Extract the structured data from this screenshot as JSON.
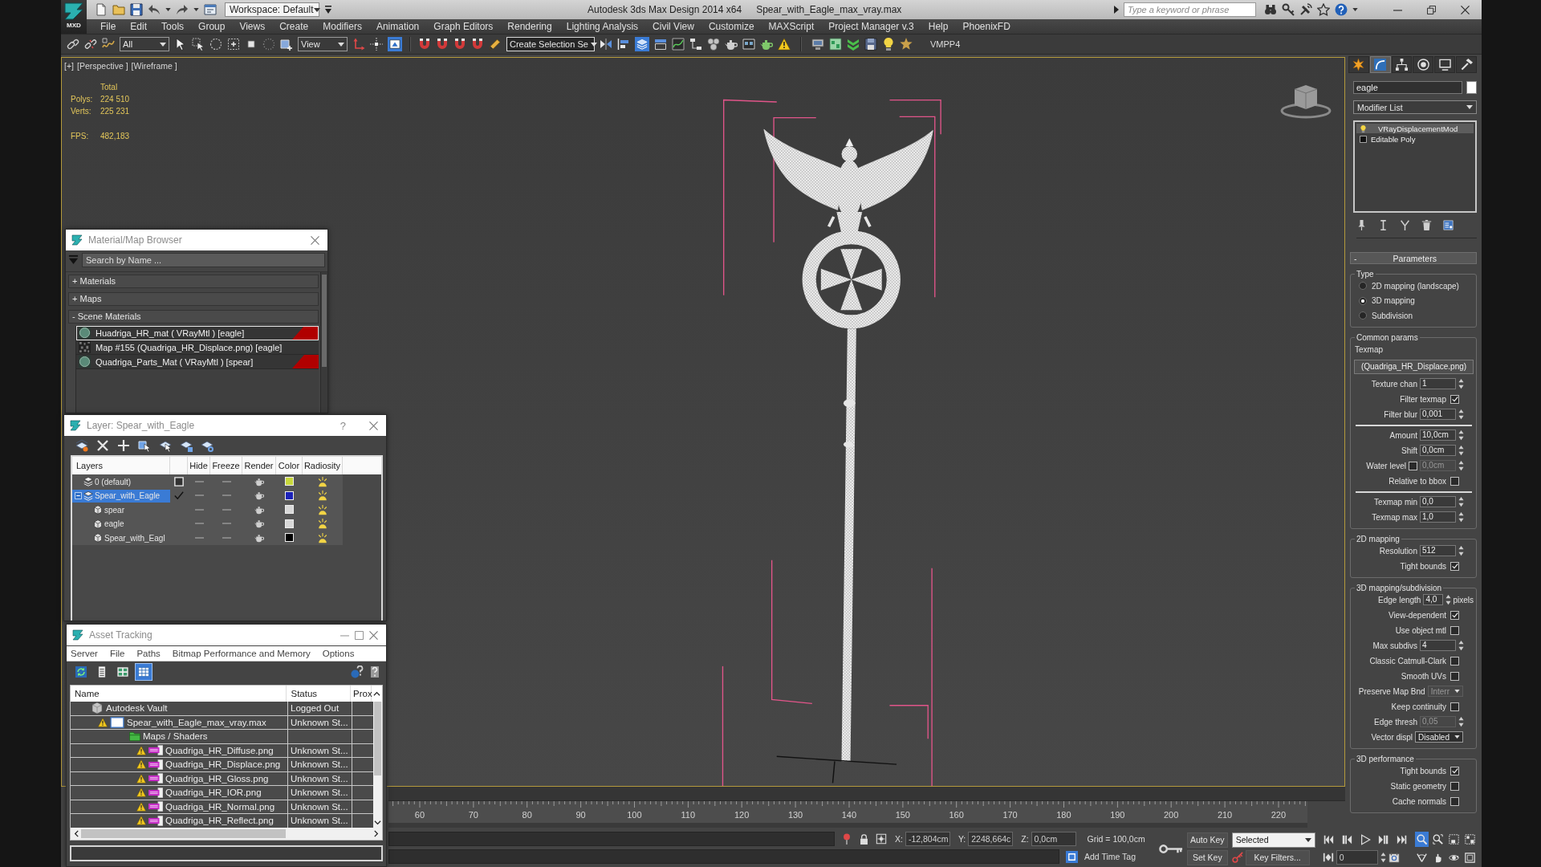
{
  "title_bar": {
    "app_button": "MXD",
    "workspace": "Workspace: Default",
    "app_title": "Autodesk 3ds Max Design 2014 x64",
    "file_name": "Spear_with_Eagle_max_vray.max",
    "search": {
      "placeholder": "Type a keyword or phrase"
    }
  },
  "menu_bar": [
    "File",
    "Edit",
    "Tools",
    "Group",
    "Views",
    "Create",
    "Modifiers",
    "Animation",
    "Graph Editors",
    "Rendering",
    "Lighting Analysis",
    "Civil View",
    "Customize",
    "MAXScript",
    "Project Manager v.3",
    "Help",
    "PhoenixFD"
  ],
  "toolbar": {
    "selection_filter": "All",
    "reference_coordinates": "View",
    "named_selection": "Create Selection Se",
    "shortcut_override": {
      "on": true
    },
    "layer_explorer": {
      "on": true
    },
    "plugin_label": "VMPP4"
  },
  "viewport": {
    "labels": [
      "[+]",
      "[Perspective ]",
      "[Wireframe ]"
    ],
    "stats": {
      "heading": "Total",
      "rows": [
        {
          "label": "Polys:",
          "value": "224 510"
        },
        {
          "label": "Verts:",
          "value": "225 231"
        }
      ],
      "fps": {
        "label": "FPS:",
        "value": "482,183"
      }
    }
  },
  "material_browser": {
    "title": "Material/Map Browser",
    "search": {
      "placeholder": "Search by Name ..."
    },
    "groups": [
      {
        "sign": "+",
        "label": "Materials"
      },
      {
        "sign": "+",
        "label": "Maps"
      },
      {
        "sign": "-",
        "label": "Scene Materials",
        "items": [
          {
            "kind": "material",
            "name": "Huadriga_HR_mat ( VRayMtl ) [eagle]",
            "selected": true,
            "in_scene": true
          },
          {
            "kind": "map",
            "name": "Map #155 (Quadriga_HR_Displace.png) [eagle]",
            "selected": false,
            "in_scene": false
          },
          {
            "kind": "material",
            "name": "Quadriga_Parts_Mat ( VRayMtl ) [spear]",
            "selected": false,
            "in_scene": true
          }
        ]
      }
    ]
  },
  "layer_manager": {
    "title": "Layer: Spear_with_Eagle",
    "help": "?",
    "columns": [
      "Layers",
      "Hide",
      "Freeze",
      "Render",
      "Color",
      "Radiosity"
    ],
    "layers": [
      {
        "kind": "layer",
        "name": "0 (default)",
        "current": false,
        "selected": false,
        "hidden": false,
        "frozen": false,
        "renderable": true,
        "radiosity": true,
        "color": "#c8d83c"
      },
      {
        "kind": "layer",
        "name": "Spear_with_Eagle",
        "current": true,
        "selected": true,
        "expanded": true,
        "hidden": false,
        "frozen": false,
        "renderable": true,
        "radiosity": true,
        "color": "#1c22b8",
        "children": [
          {
            "kind": "object",
            "name": "spear",
            "selected": false,
            "hidden": false,
            "frozen": false,
            "renderable": true,
            "radiosity": true,
            "color": "#d8d8d8"
          },
          {
            "kind": "object",
            "name": "eagle",
            "selected": false,
            "hidden": false,
            "frozen": false,
            "renderable": true,
            "radiosity": true,
            "color": "#d8d8d8"
          },
          {
            "kind": "object",
            "name": "Spear_with_Eagl",
            "selected": false,
            "hidden": false,
            "frozen": false,
            "renderable": true,
            "radiosity": true,
            "color": "#000000"
          }
        ]
      }
    ]
  },
  "asset_tracking": {
    "title": "Asset Tracking",
    "menu": [
      "Server",
      "File",
      "Paths",
      "Bitmap Performance and Memory",
      "Options"
    ],
    "view_buttons": [
      {
        "selected": false
      },
      {
        "selected": false
      },
      {
        "selected": false
      },
      {
        "selected": true
      }
    ],
    "columns": [
      "Name",
      "Status",
      "Prox"
    ],
    "rows": [
      {
        "kind": "vault",
        "name": "Autodesk Vault",
        "status": "Logged Out",
        "warning": false,
        "children": [
          {
            "kind": "max_file",
            "name": "Spear_with_Eagle_max_vray.max",
            "status": "Unknown St...",
            "warning": true,
            "children": [
              {
                "kind": "folder",
                "name": "Maps / Shaders",
                "warning": false,
                "children": [
                  {
                    "kind": "png",
                    "name": "Quadriga_HR_Diffuse.png",
                    "status": "Unknown St...",
                    "warning": true
                  },
                  {
                    "kind": "png",
                    "name": "Quadriga_HR_Displace.png",
                    "status": "Unknown St...",
                    "warning": true
                  },
                  {
                    "kind": "png",
                    "name": "Quadriga_HR_Gloss.png",
                    "status": "Unknown St...",
                    "warning": true
                  },
                  {
                    "kind": "png",
                    "name": "Quadriga_HR_IOR.png",
                    "status": "Unknown St...",
                    "warning": true
                  },
                  {
                    "kind": "png",
                    "name": "Quadriga_HR_Normal.png",
                    "status": "Unknown St...",
                    "warning": true
                  },
                  {
                    "kind": "png",
                    "name": "Quadriga_HR_Reflect.png",
                    "status": "Unknown St...",
                    "warning": true
                  }
                ]
              }
            ]
          }
        ]
      }
    ]
  },
  "command_panel": {
    "tabs": [
      {
        "selected": false
      },
      {
        "selected": true
      },
      {
        "selected": false
      },
      {
        "selected": false
      },
      {
        "selected": false
      },
      {
        "selected": false
      }
    ],
    "object_name": "eagle",
    "modifier_list": "Modifier List",
    "stack": [
      {
        "kind": "modifier",
        "name": "VRayDisplacementMod",
        "selected": true
      },
      {
        "kind": "base_object",
        "name": "Editable Poly",
        "selected": false
      }
    ],
    "rollout": {
      "sign": "-",
      "title": "Parameters",
      "groups": [
        {
          "title": "Type",
          "rows": [
            {
              "kind": "radio",
              "label": "2D mapping (landscape)",
              "selected": false
            },
            {
              "kind": "radio",
              "label": "3D mapping",
              "selected": true
            },
            {
              "kind": "radio",
              "label": "Subdivision",
              "selected": false
            }
          ]
        },
        {
          "title": "Common params",
          "rows": [
            {
              "kind": "caption",
              "label": "Texmap"
            },
            {
              "kind": "map_button",
              "label": "(Quadriga_HR_Displace.png)"
            },
            {
              "kind": "spinner",
              "label": "Texture chan",
              "value": "1",
              "disabled": false
            },
            {
              "kind": "checkbox",
              "label": "Filter texmap",
              "checked": true
            },
            {
              "kind": "spinner",
              "label": "Filter blur",
              "value": "0,001",
              "disabled": false
            },
            {
              "kind": "separator"
            },
            {
              "kind": "spinner",
              "label": "Amount",
              "value": "10,0cm",
              "disabled": false
            },
            {
              "kind": "spinner",
              "label": "Shift",
              "value": "0,0cm",
              "disabled": false
            },
            {
              "kind": "check_spinner",
              "label": "Water level",
              "checked": false,
              "value": "0,0cm",
              "disabled": true
            },
            {
              "kind": "checkbox",
              "label": "Relative to bbox",
              "checked": false
            },
            {
              "kind": "separator"
            },
            {
              "kind": "spinner",
              "label": "Texmap min",
              "value": "0,0",
              "disabled": false
            },
            {
              "kind": "spinner",
              "label": "Texmap max",
              "value": "1,0",
              "disabled": false
            }
          ]
        },
        {
          "title": "2D mapping",
          "rows": [
            {
              "kind": "spinner",
              "label": "Resolution",
              "value": "512",
              "disabled": false
            },
            {
              "kind": "checkbox",
              "label": "Tight bounds",
              "checked": true
            }
          ]
        },
        {
          "title": "3D mapping/subdivision",
          "rows": [
            {
              "kind": "spinner",
              "label": "Edge length",
              "value": "4,0",
              "unit": "pixels",
              "disabled": false
            },
            {
              "kind": "checkbox",
              "label": "View-dependent",
              "checked": true
            },
            {
              "kind": "checkbox",
              "label": "Use object mtl",
              "checked": false
            },
            {
              "kind": "spinner",
              "label": "Max subdivs",
              "value": "4",
              "disabled": false
            },
            {
              "kind": "checkbox",
              "label": "Classic Catmull-Clark",
              "checked": false
            },
            {
              "kind": "checkbox",
              "label": "Smooth UVs",
              "checked": false
            },
            {
              "kind": "dropdown",
              "label": "Preserve Map Bnd",
              "value": "Interr",
              "disabled": true
            },
            {
              "kind": "checkbox",
              "label": "Keep continuity",
              "checked": false
            },
            {
              "kind": "spinner",
              "label": "Edge thresh",
              "value": "0,05",
              "disabled": true
            },
            {
              "kind": "dropdown",
              "label": "Vector displ",
              "value": "Disabled",
              "disabled": false
            }
          ]
        },
        {
          "title": "3D performance",
          "rows": [
            {
              "kind": "checkbox",
              "label": "Tight bounds",
              "checked": true
            },
            {
              "kind": "checkbox",
              "label": "Static geometry",
              "checked": false
            },
            {
              "kind": "checkbox",
              "label": "Cache normals",
              "checked": false
            }
          ]
        }
      ]
    }
  },
  "timeline": {
    "labels": [
      "60",
      "70",
      "80",
      "90",
      "100",
      "110",
      "120",
      "130",
      "140",
      "150",
      "160",
      "170",
      "180",
      "190",
      "200",
      "210",
      "220"
    ]
  },
  "status_bar": {
    "coordinates": [
      {
        "axis": "X:",
        "value": "-12,804cm"
      },
      {
        "axis": "Y:",
        "value": "2248,664c"
      },
      {
        "axis": "Z:",
        "value": "0,0cm"
      }
    ],
    "grid": "Grid = 100,0cm",
    "time_tag": "Add Time Tag",
    "auto_key": {
      "label": "Auto Key",
      "on": false
    },
    "key_set": "Selected",
    "set_key": "Set Key",
    "key_filters": "Key Filters...",
    "frame": "0",
    "navigation": [
      {
        "selected": true
      },
      {
        "selected": false
      },
      {
        "selected": false
      },
      {
        "selected": false
      },
      {
        "selected": false
      },
      {
        "selected": false
      },
      {
        "selected": false
      },
      {
        "selected": false
      }
    ]
  }
}
